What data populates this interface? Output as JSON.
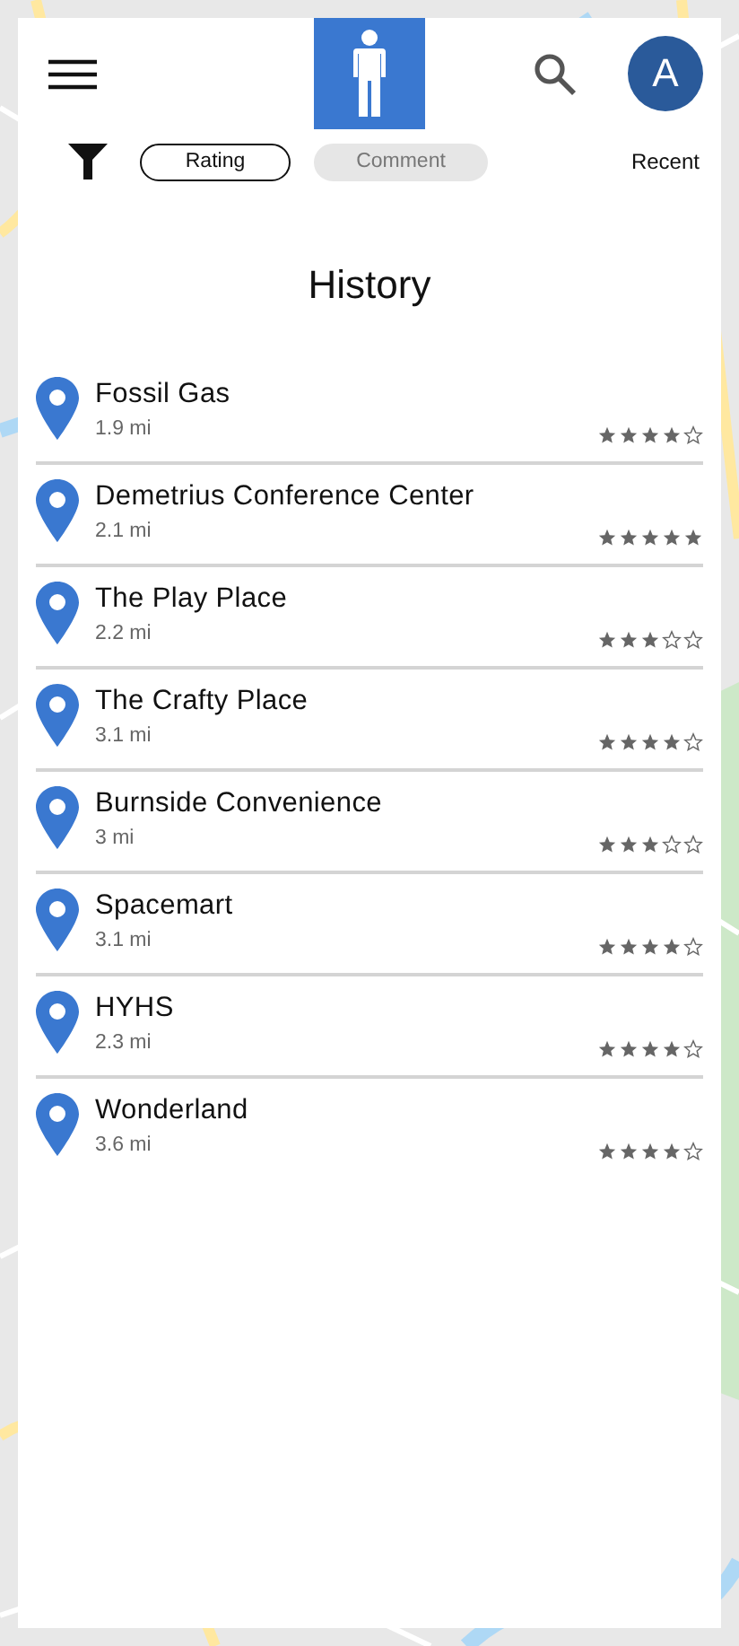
{
  "header": {
    "avatar_letter": "A"
  },
  "filters": {
    "chips": [
      {
        "label": "Rating",
        "selected": true
      },
      {
        "label": "Comment",
        "selected": false
      }
    ],
    "sort": "Recent"
  },
  "title": "History",
  "places": [
    {
      "name": "Fossil Gas",
      "distance": "1.9 mi",
      "stars": 4
    },
    {
      "name": "Demetrius Conference Center",
      "distance": "2.1 mi",
      "stars": 5
    },
    {
      "name": "The Play Place",
      "distance": "2.2 mi",
      "stars": 3
    },
    {
      "name": "The Crafty Place",
      "distance": "3.1 mi",
      "stars": 4
    },
    {
      "name": "Burnside Convenience",
      "distance": "3 mi",
      "stars": 3
    },
    {
      "name": "Spacemart",
      "distance": "3.1 mi",
      "stars": 4
    },
    {
      "name": "HYHS",
      "distance": "2.3 mi",
      "stars": 4
    },
    {
      "name": "Wonderland",
      "distance": "3.6 mi",
      "stars": 4
    }
  ]
}
